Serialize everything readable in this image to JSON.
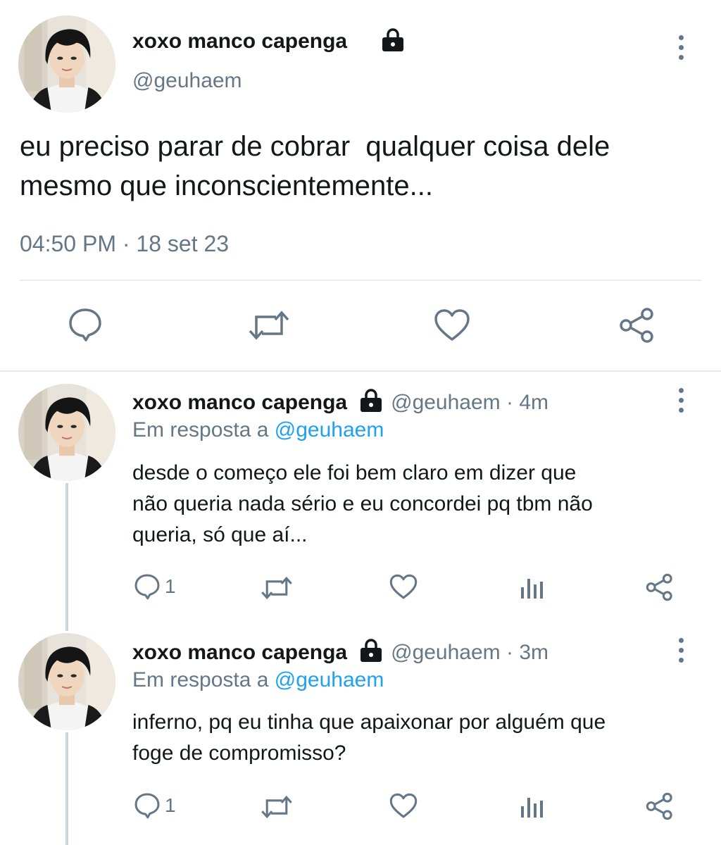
{
  "main": {
    "display_name": "xoxo manco capenga",
    "handle": "@geuhaem",
    "text_line1": "eu preciso parar de cobrar  qualquer coisa dele",
    "text_line2": "mesmo que inconscientemente...",
    "timestamp": "04:50 PM · 18 set 23"
  },
  "replies": [
    {
      "display_name": "xoxo manco capenga",
      "handle_time": "@geuhaem · 4m",
      "reply_prefix": "Em resposta a ",
      "reply_mention": "@geuhaem",
      "text_lines": [
        "desde o começo ele foi bem claro em dizer que",
        "não queria nada sério e eu concordei pq tbm não",
        "queria, só que aí..."
      ],
      "reply_count": "1"
    },
    {
      "display_name": "xoxo manco capenga",
      "handle_time": "@geuhaem · 3m",
      "reply_prefix": "Em resposta a ",
      "reply_mention": "@geuhaem",
      "text_lines": [
        "inferno, pq eu tinha que apaixonar por alguém que",
        "foge de compromisso?"
      ],
      "reply_count": "1"
    }
  ],
  "icons": {
    "lock": "lock-icon",
    "more": "more-vertical-icon",
    "reply": "reply-bubble-icon",
    "retweet": "retweet-icon",
    "like": "heart-icon",
    "analytics": "analytics-icon",
    "share": "share-icon"
  },
  "colors": {
    "text": "#14171a",
    "secondary": "#657786",
    "link": "#1da1f2",
    "divider": "#e6ecf0"
  }
}
